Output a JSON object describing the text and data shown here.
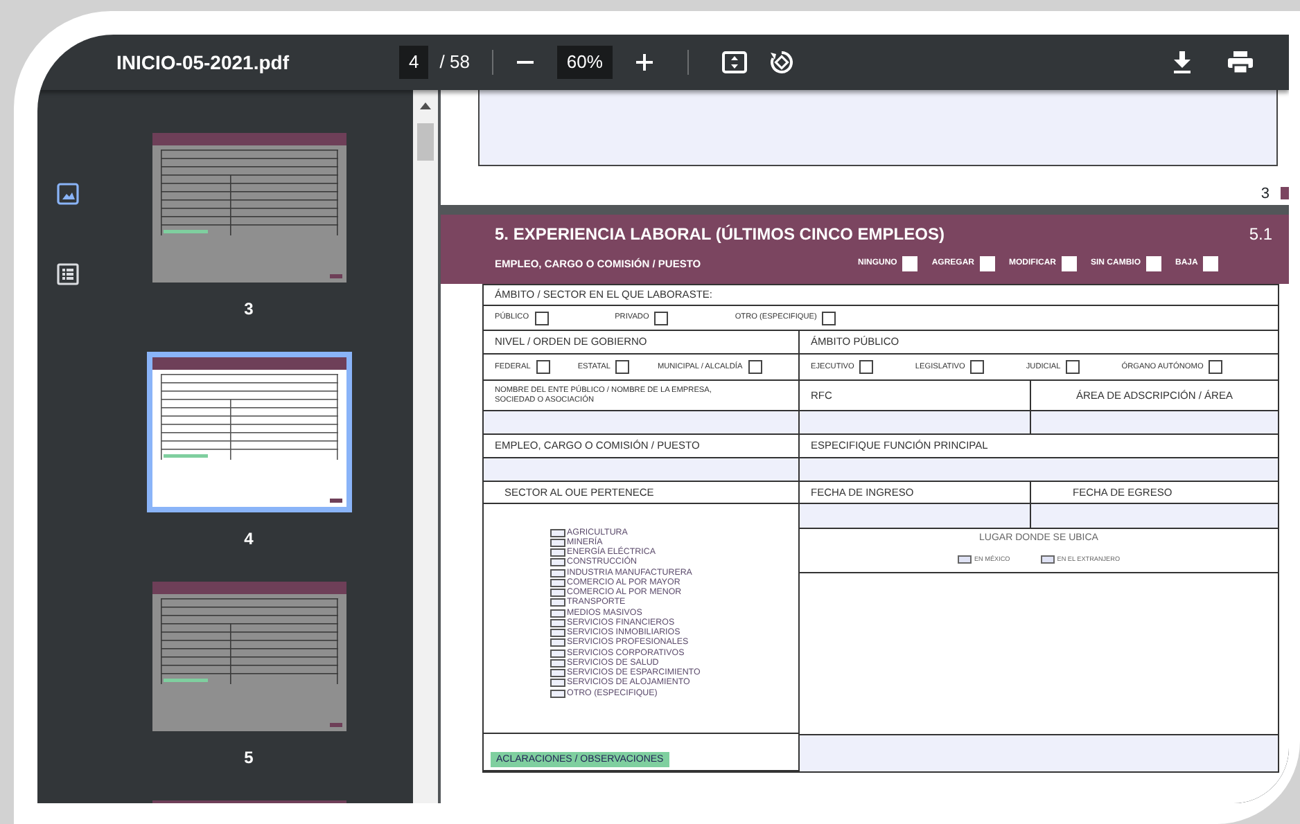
{
  "toolbar": {
    "title": "INICIO-05-2021.pdf",
    "page_input": "4",
    "page_count": "/ 58",
    "zoom": "60%"
  },
  "sidebar": {
    "views": [
      {
        "kind": "thumbnails",
        "selected": true
      },
      {
        "kind": "outline",
        "selected": false
      }
    ],
    "thumbnails": [
      {
        "label": "3",
        "selected": false
      },
      {
        "label": "4",
        "selected": true
      },
      {
        "label": "5",
        "selected": false
      },
      {
        "selected": false
      }
    ]
  },
  "previous_page": {
    "page_number": "3"
  },
  "section": {
    "title": "5. EXPERIENCIA LABORAL (ÚLTIMOS CINCO EMPLEOS)",
    "number": "5.1",
    "subtitle": "EMPLEO, CARGO O COMISIÓN / PUESTO",
    "actions": [
      {
        "label": "NINGUNO",
        "checked": false
      },
      {
        "label": "AGREGAR",
        "checked": false
      },
      {
        "label": "MODIFICAR",
        "checked": false
      },
      {
        "label": "SIN CAMBIO",
        "checked": false
      },
      {
        "label": "BAJA",
        "checked": false
      }
    ]
  },
  "form": {
    "ambito_label": "ÁMBITO / SECTOR EN EL QUE LABORASTE:",
    "ambito_options": [
      {
        "label": "PÚBLICO",
        "checked": false
      },
      {
        "label": "PRIVADO",
        "checked": false
      },
      {
        "label": "OTRO (ESPECIFIQUE)",
        "checked": false
      }
    ],
    "nivel_label": "NIVEL / ORDEN DE GOBIERNO",
    "ambito_publico_label": "ÁMBITO PÚBLICO",
    "nivel_options": [
      {
        "label": "FEDERAL",
        "checked": false
      },
      {
        "label": "ESTATAL",
        "checked": false
      },
      {
        "label": "MUNICIPAL / ALCALDÍA",
        "checked": false
      }
    ],
    "ambito_publico_options": [
      {
        "label": "EJECUTIVO",
        "checked": false
      },
      {
        "label": "LEGISLATIVO",
        "checked": false
      },
      {
        "label": "JUDICIAL",
        "checked": false
      },
      {
        "label": "ÓRGANO AUTÓNOMO",
        "checked": false
      }
    ],
    "nombre_label": "NOMBRE DEL ENTE PÚBLICO / NOMBRE DE LA EMPRESA, SOCIEDAD O ASOCIACIÓN",
    "rfc_label": "RFC",
    "area_label": "ÁREA DE ADSCRIPCIÓN / ÁREA",
    "empleo_label": "EMPLEO, CARGO O COMISIÓN / PUESTO",
    "funcion_label": "ESPECIFIQUE FUNCIÓN PRINCIPAL",
    "sector_label": "SECTOR AL OUE PERTENECE",
    "fecha_ingreso_label": "FECHA DE INGRESO",
    "fecha_egreso_label": "FECHA DE EGRESO",
    "sectors": [
      {
        "label": "AGRICULTURA",
        "checked": false
      },
      {
        "label": "MINERÍA",
        "checked": false
      },
      {
        "label": "ENERGÍA ELÉCTRICA",
        "checked": false
      },
      {
        "label": "CONSTRUCCIÓN",
        "checked": false
      },
      {
        "label": "INDUSTRIA MANUFACTURERA",
        "checked": false
      },
      {
        "label": "COMERCIO AL POR MAYOR",
        "checked": false
      },
      {
        "label": "COMERCIO AL POR MENOR",
        "checked": false
      },
      {
        "label": "TRANSPORTE",
        "checked": false
      },
      {
        "label": "MEDIOS MASIVOS",
        "checked": false
      },
      {
        "label": "SERVICIOS FINANCIEROS",
        "checked": false
      },
      {
        "label": "SERVICIOS INMOBILIARIOS",
        "checked": false
      },
      {
        "label": "SERVICIOS PROFESIONALES",
        "checked": false
      },
      {
        "label": "SERVICIOS CORPORATIVOS",
        "checked": false
      },
      {
        "label": "SERVICIOS DE SALUD",
        "checked": false
      },
      {
        "label": "SERVICIOS DE ESPARCIMIENTO",
        "checked": false
      },
      {
        "label": "SERVICIOS DE ALOJAMIENTO",
        "checked": false
      },
      {
        "label": "OTRO (ESPECIFIQUE)",
        "checked": false
      }
    ],
    "lugar_label": "LUGAR DONDE SE UBICA",
    "lugar_options": [
      {
        "label": "EN MÉXICO",
        "checked": false
      },
      {
        "label": "EN EL EXTRANJERO",
        "checked": false
      }
    ],
    "aclaraciones_label": "ACLARACIONES / OBSERVACIONES"
  }
}
